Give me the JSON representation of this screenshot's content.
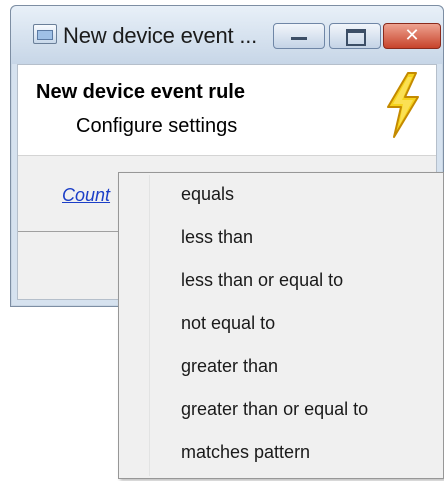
{
  "window": {
    "title": "New device event ...",
    "close_glyph": "✕",
    "icons": {
      "app": "app-window-icon",
      "minimize": "minimize-icon",
      "maximize": "maximize-icon",
      "close": "close-icon"
    }
  },
  "header": {
    "title": "New device event rule",
    "subtitle": "Configure settings",
    "icon": "lightning-bolt-icon",
    "icon_colors": {
      "fill": "#f6d31d",
      "stroke": "#c48a00"
    }
  },
  "rule": {
    "field_link": "Count",
    "operator_link": "equals",
    "value": "",
    "link_color": "#1b3ec7"
  },
  "operator_menu": {
    "items": [
      "equals",
      "less than",
      "less than or equal to",
      "not equal to",
      "greater than",
      "greater than or equal to",
      "matches pattern"
    ]
  }
}
